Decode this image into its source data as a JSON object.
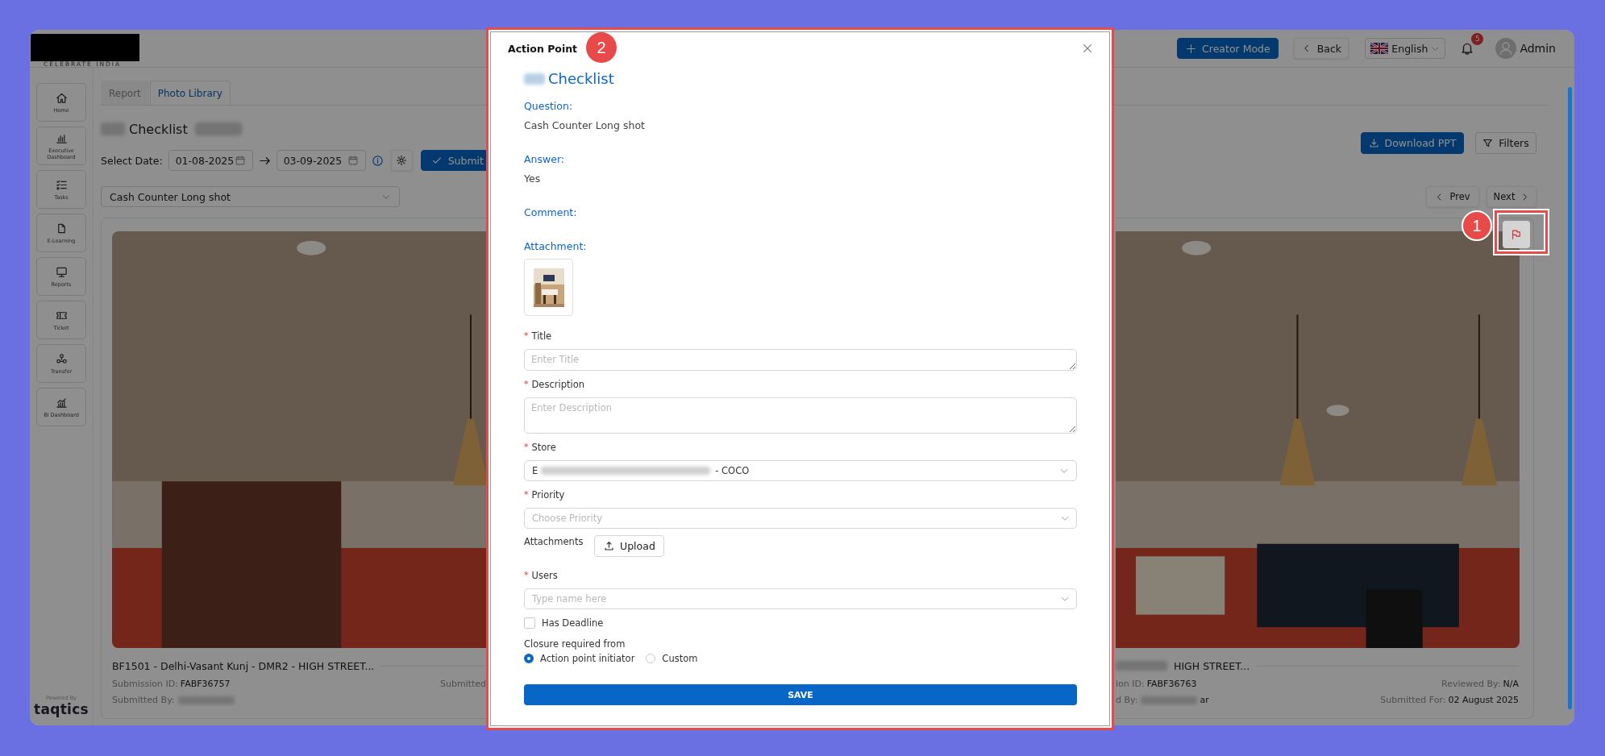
{
  "app": {
    "brand": {
      "tagline": "CELEBRATE INDIA"
    },
    "header": {
      "creator_button": "Creator Mode",
      "back_button": "Back",
      "language": "English",
      "notification_count": "5",
      "user_name": "Admin"
    },
    "sidebar": {
      "items": [
        {
          "kind": "home",
          "label": "Home"
        },
        {
          "kind": "chart",
          "label": "Executive Dashboard"
        },
        {
          "kind": "tasks",
          "label": "Tasks"
        },
        {
          "kind": "document",
          "label": "E-Learning"
        },
        {
          "kind": "monitor",
          "label": "Reports"
        },
        {
          "kind": "ticket",
          "label": "Ticket"
        },
        {
          "kind": "transfer",
          "label": "Transfer"
        },
        {
          "kind": "trend",
          "label": "BI Dashboard"
        }
      ],
      "powered_by": "Powered By",
      "vendor_logo": "taqtics"
    },
    "tabs": [
      {
        "label": "Report",
        "selected": false
      },
      {
        "label": "Photo Library",
        "selected": true
      }
    ],
    "page_title": "Checklist",
    "date_filter": {
      "label": "Select Date:",
      "start": "01-08-2025",
      "end": "03-09-2025",
      "submit_button": "Submit"
    },
    "toolbar": {
      "download_button": "Download PPT",
      "filters_button": "Filters"
    },
    "question_select": {
      "value": "Cash Counter Long shot"
    },
    "pager": {
      "prev_button": "Prev",
      "next_button": "Next"
    },
    "cards": [
      {
        "title": "BF1501 - Delhi-Vasant Kunj - DMR2 - HIGH STREET...",
        "lines_left": [
          {
            "label": "Submission ID:",
            "value": "FABF36757"
          },
          {
            "label": "Submitted By:",
            "redacted": true
          }
        ],
        "lines_right": [
          {
            "label": "Submitted"
          }
        ]
      },
      {
        "title": "HIGH STREET...",
        "title_redacted": true,
        "lines_left": [
          {
            "label": "ion ID:",
            "value": "FABF36763"
          },
          {
            "label": "d By:",
            "redacted": true,
            "value": "ar"
          }
        ],
        "lines_right": [
          {
            "label": "Reviewed By:",
            "value": "N/A"
          },
          {
            "label": "Submitted For:",
            "value": "02 August 2025"
          }
        ],
        "flag_annotation": "1"
      }
    ]
  },
  "modal": {
    "title": "Action Point",
    "annotation": "2",
    "heading": "Checklist",
    "required_mark": "*",
    "details": [
      {
        "kind": "text",
        "label": "Question:",
        "value": "Cash Counter Long shot"
      },
      {
        "kind": "text",
        "label": "Answer:",
        "value": "Yes"
      },
      {
        "kind": "text",
        "label": "Comment:"
      },
      {
        "label": "Attachment:"
      }
    ],
    "form": [
      {
        "kind": "textarea",
        "label": "Title",
        "required": true,
        "placeholder": "Enter Title"
      },
      {
        "kind": "textarea",
        "label": "Description",
        "required": true,
        "placeholder": "Enter Description"
      },
      {
        "kind": "select",
        "label": "Store",
        "required": true,
        "value_prefix": "E",
        "value": "- COCO"
      },
      {
        "kind": "select",
        "label": "Priority",
        "required": true,
        "placeholder": "Choose Priority"
      },
      {
        "kind": "upload",
        "label": "Attachments",
        "required": false,
        "button": "Upload"
      },
      {
        "kind": "select",
        "label": "Users",
        "required": true,
        "placeholder": "Type name here"
      },
      {
        "kind": "checkbox",
        "label": "Has Deadline",
        "checked": false
      },
      {
        "kind": "radio",
        "label": "Closure required from",
        "options": [
          {
            "label": "Action point initiator",
            "selected": true
          },
          {
            "label": "Custom",
            "selected": false
          }
        ]
      }
    ],
    "save_button": "SAVE"
  }
}
